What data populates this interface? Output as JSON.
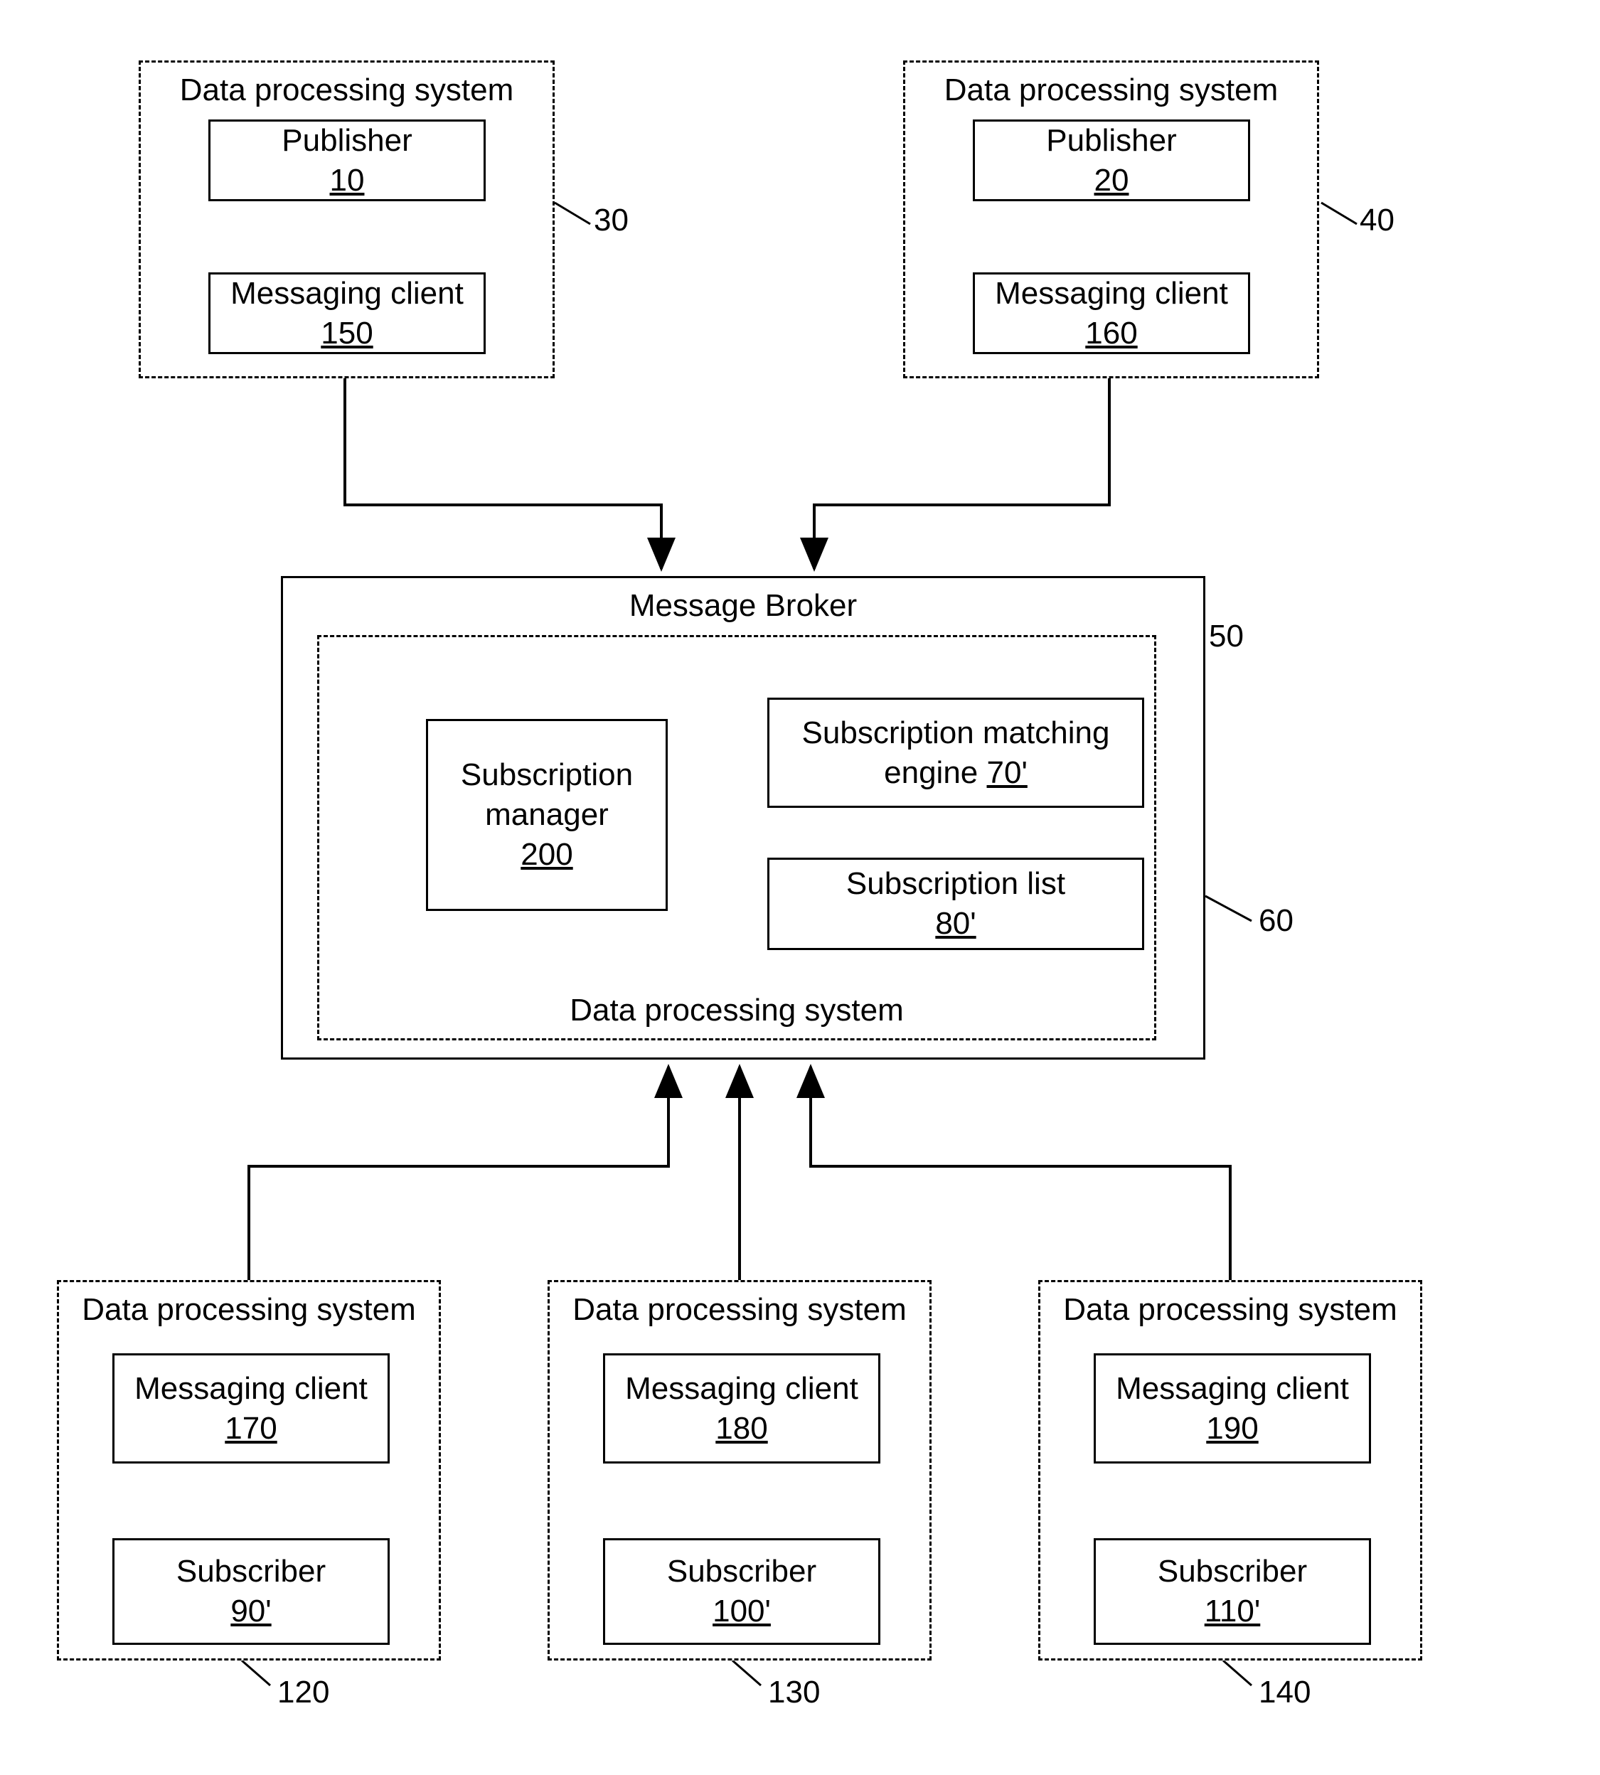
{
  "top_left": {
    "system_title": "Data processing system",
    "pub_label": "Publisher",
    "pub_num": "10",
    "msg_label": "Messaging client",
    "msg_num": "150",
    "callout": "30"
  },
  "top_right": {
    "system_title": "Data processing system",
    "pub_label": "Publisher",
    "pub_num": "20",
    "msg_label": "Messaging client",
    "msg_num": "160",
    "callout": "40"
  },
  "broker": {
    "title": "Message Broker",
    "system_title": "Data processing system",
    "sub_mgr_label": "Subscription",
    "sub_mgr_label_2": "manager",
    "sub_mgr_num": "200",
    "match_label": "Subscription matching",
    "match_label_2": "engine ",
    "match_num": "70'",
    "list_label": "Subscription list",
    "list_num": "80'",
    "callout_inner": "50",
    "callout_outer": "60"
  },
  "bottom_left": {
    "system_title": "Data processing system",
    "msg_label": "Messaging client",
    "msg_num": "170",
    "sub_label": "Subscriber",
    "sub_num": "90'",
    "callout": "120"
  },
  "bottom_mid": {
    "system_title": "Data processing system",
    "msg_label": "Messaging client",
    "msg_num": "180",
    "sub_label": "Subscriber",
    "sub_num": "100'",
    "callout": "130"
  },
  "bottom_right": {
    "system_title": "Data processing system",
    "msg_label": "Messaging client",
    "msg_num": "190",
    "sub_label": "Subscriber",
    "sub_num": "110'",
    "callout": "140"
  }
}
